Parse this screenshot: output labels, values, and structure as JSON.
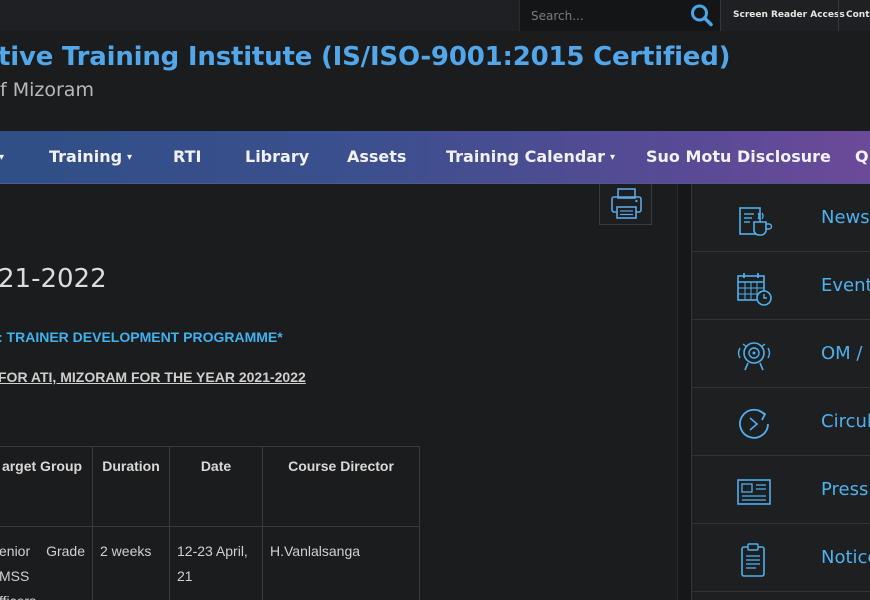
{
  "topbar": {
    "search_placeholder": "Search...",
    "links": [
      "Screen Reader Access",
      "Conta"
    ]
  },
  "header": {
    "title": "tive Training Institute (IS/ISO-9001:2015 Certified)",
    "subtitle": "f Mizoram"
  },
  "nav": {
    "items": [
      {
        "label": "",
        "dropdown": true
      },
      {
        "label": "Training",
        "dropdown": true
      },
      {
        "label": "RTI",
        "dropdown": false
      },
      {
        "label": "Library",
        "dropdown": false
      },
      {
        "label": "Assets",
        "dropdown": false
      },
      {
        "label": "Training Calendar",
        "dropdown": true
      },
      {
        "label": "Suo Motu Disclosure",
        "dropdown": false
      },
      {
        "label": "Q",
        "dropdown": false
      }
    ]
  },
  "main": {
    "heading": "21-2022",
    "subtitle1": ": TRAINER DEVELOPMENT PROGRAMME*",
    "subtitle2": "FOR ATI, MIZORAM FOR THE YEAR 2021-2022",
    "table": {
      "headers": [
        "arget Group",
        "Duration",
        "Date",
        "Course Director"
      ],
      "rows": [
        {
          "target_group": "enior Grade MSS",
          "target_group_l2": "fficers",
          "duration": "2 weeks",
          "date": "12-23 April, 21",
          "director": "H.Vanlalsanga"
        }
      ]
    }
  },
  "sidebar": {
    "items": [
      {
        "label": "News",
        "icon": "news-icon"
      },
      {
        "label": "Events",
        "icon": "calendar-icon"
      },
      {
        "label": "OM / I",
        "icon": "alarm-bell-icon"
      },
      {
        "label": "Circula",
        "icon": "refresh-icon"
      },
      {
        "label": "Press",
        "icon": "newspaper-icon"
      },
      {
        "label": "Notice",
        "icon": "clipboard-icon"
      }
    ]
  },
  "colors": {
    "title_blue": "#52a7ea",
    "link_blue": "#3fb2ef",
    "nav_start": "#2f4f86",
    "nav_end": "#6b4a99",
    "background": "#1b1c1e"
  }
}
